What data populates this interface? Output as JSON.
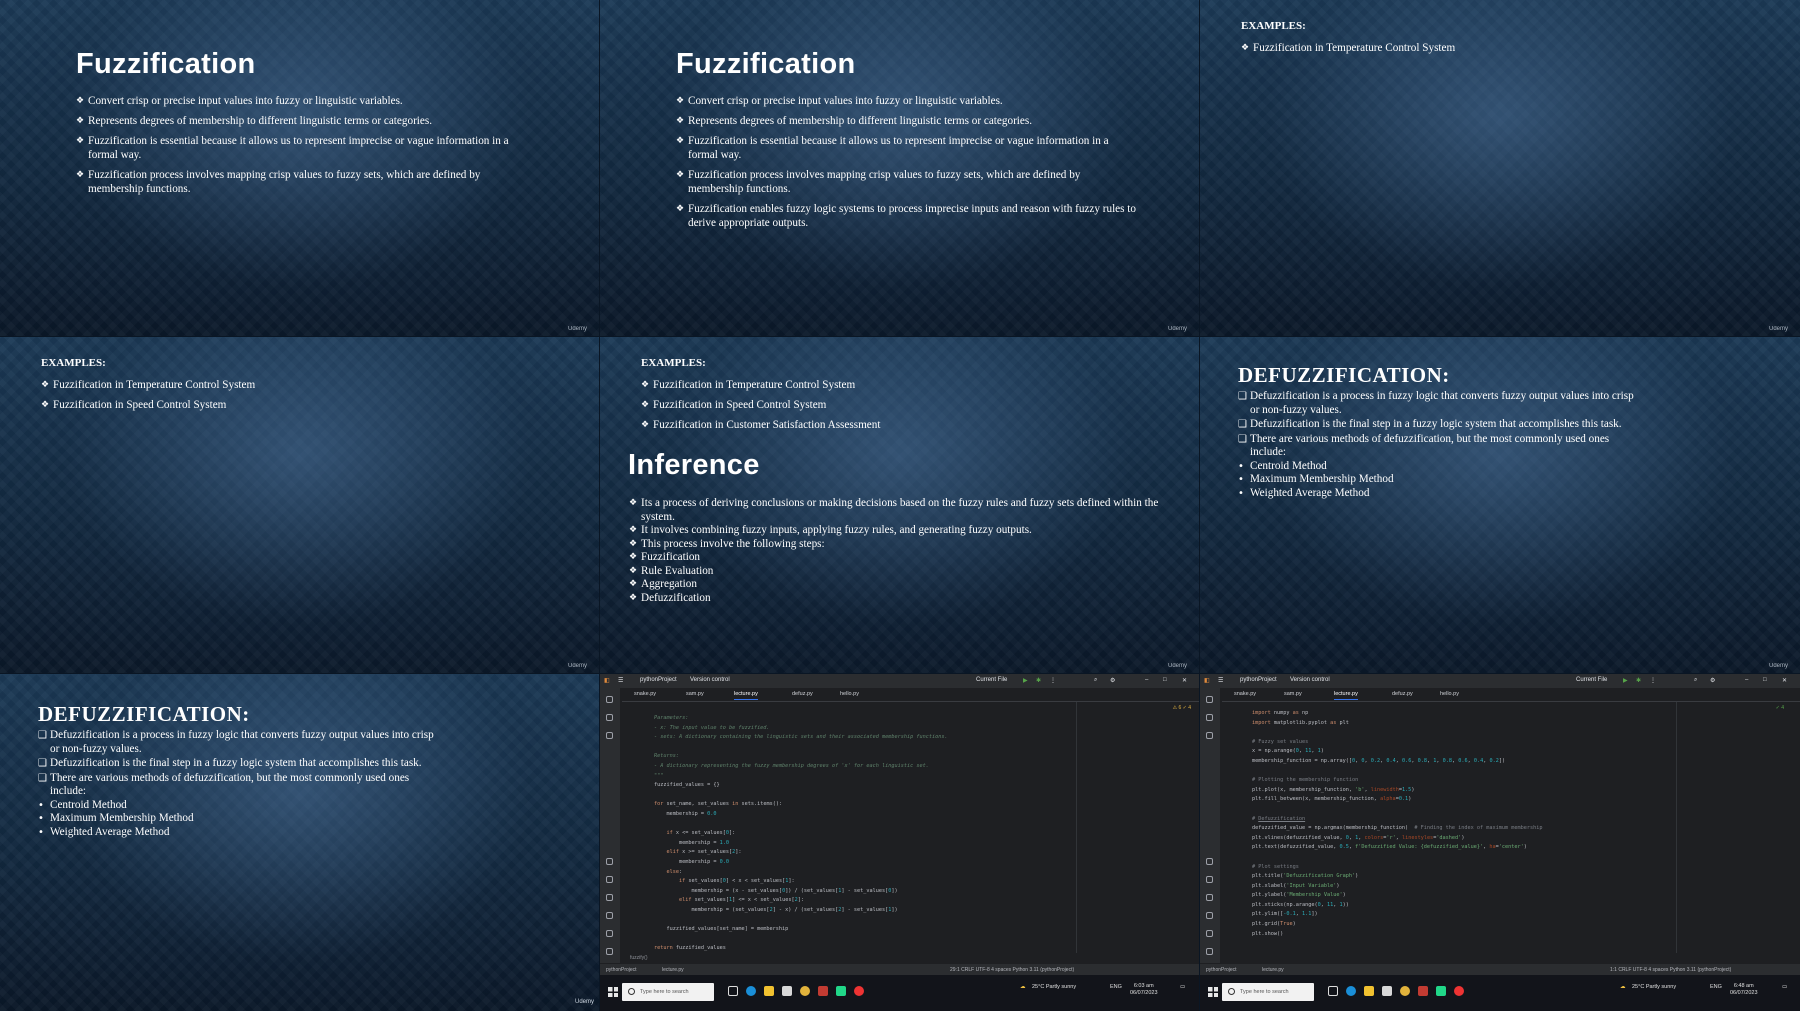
{
  "watermark": "Udemy",
  "fuzz_title": "Fuzzification",
  "fuzz_bullets": [
    "Convert crisp or precise input values into fuzzy or linguistic variables.",
    "Represents degrees of membership to different linguistic terms or categories.",
    "Fuzzification is essential because it allows us to represent imprecise or vague information in a formal way.",
    "Fuzzification process involves mapping crisp values to fuzzy sets, which are defined by membership functions.",
    "Fuzzification enables fuzzy logic systems to process imprecise inputs and reason with fuzzy rules to derive appropriate outputs."
  ],
  "examples_title": "EXAMPLES:",
  "examples": [
    "Fuzzification in Temperature Control System",
    "Fuzzification in Speed Control System",
    "Fuzzification in Customer Satisfaction Assessment"
  ],
  "inference_title": "Inference",
  "inference_bullets": [
    "Its a process of deriving conclusions or making decisions based on the fuzzy rules and fuzzy sets defined within the system.",
    " It involves combining fuzzy inputs, applying fuzzy rules, and generating fuzzy outputs.",
    "This process involve the following steps:",
    " Fuzzification",
    "Rule Evaluation",
    "Aggregation",
    "Defuzzification"
  ],
  "defuzz_title": "DEFUZZIFICATION:",
  "defuzz_bullets": [
    "Defuzzification  is a process in fuzzy logic that converts fuzzy output values into crisp or non-fuzzy values.",
    "Defuzzification is the final step in a fuzzy logic system that accomplishes this task.",
    "There are various methods of defuzzification, but the most commonly used ones include:"
  ],
  "defuzz_methods": [
    "Centroid Method",
    "Maximum Membership Method",
    "Weighted Average Method"
  ],
  "ide": {
    "project": "pythonProject",
    "vcs": "Version control",
    "run_config": "Current File",
    "tabs": [
      "snake.py",
      "sam.py",
      "lecture.py",
      "defuz.py",
      "hello.py"
    ],
    "active_tab": "lecture.py",
    "breadcrumb_left": "pythonProject",
    "breadcrumb_file": "lecture.py",
    "status_left": "29:1  CRLF  UTF-8  4 spaces  Python 3.11 (pythonProject)",
    "status_right": "1:1  CRLF  UTF-8  4 spaces  Python 3.11 (pythonProject)",
    "fn_crumb": "fuzzify()",
    "warnings_left": "⚠ 6  ✓ 4",
    "warnings_right": "✓ 4"
  },
  "taskbar": {
    "search_placeholder": "Type here to search",
    "weather": "25°C  Partly sunny",
    "lang": "ENG",
    "clock_left_time": "6:03 am",
    "clock_left_date": "06/07/2023",
    "clock_right_time": "6:48 am",
    "clock_right_date": "06/07/2023"
  }
}
